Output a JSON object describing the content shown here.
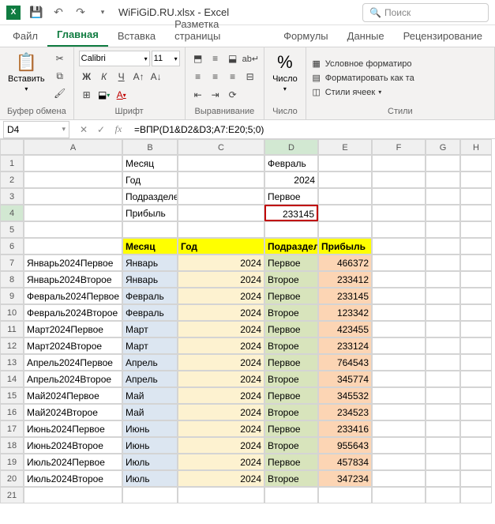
{
  "title": "WiFiGiD.RU.xlsx - Excel",
  "search_placeholder": "Поиск",
  "tabs": [
    "Файл",
    "Главная",
    "Вставка",
    "Разметка страницы",
    "Формулы",
    "Данные",
    "Рецензирование"
  ],
  "active_tab": 1,
  "paste_label": "Вставить",
  "clipboard_group": "Буфер обмена",
  "font_group": "Шрифт",
  "align_group": "Выравнивание",
  "number_group": "Число",
  "styles_group": "Стили",
  "font_name": "Calibri",
  "font_size": "11",
  "style_links": {
    "cond": "Условное форматиро",
    "table": "Форматировать как та",
    "cell": "Стили ячеек"
  },
  "namebox": "D4",
  "formula": "=ВПР(D1&D2&D3;A7:E20;5;0)",
  "cols": [
    "",
    "A",
    "B",
    "C",
    "D",
    "E",
    "F",
    "G",
    "H"
  ],
  "rows": [
    {
      "n": 1,
      "b": "Месяц",
      "d": "Февраль"
    },
    {
      "n": 2,
      "b": "Год",
      "d": "2024"
    },
    {
      "n": 3,
      "b": "Подразделение",
      "d": "Первое"
    },
    {
      "n": 4,
      "b": "Прибыль",
      "d": "233145"
    },
    {
      "n": 5
    },
    {
      "n": 6,
      "hdr": true,
      "b": "Месяц",
      "c": "Год",
      "d": "Подразделение",
      "e": "Прибыль"
    },
    {
      "n": 7,
      "a": "Январь2024Первое",
      "b": "Январь",
      "c": "2024",
      "d": "Первое",
      "e": "466372"
    },
    {
      "n": 8,
      "a": "Январь2024Второе",
      "b": "Январь",
      "c": "2024",
      "d": "Второе",
      "e": "233412"
    },
    {
      "n": 9,
      "a": "Февраль2024Первое",
      "b": "Февраль",
      "c": "2024",
      "d": "Первое",
      "e": "233145"
    },
    {
      "n": 10,
      "a": "Февраль2024Второе",
      "b": "Февраль",
      "c": "2024",
      "d": "Второе",
      "e": "123342"
    },
    {
      "n": 11,
      "a": "Март2024Первое",
      "b": "Март",
      "c": "2024",
      "d": "Первое",
      "e": "423455"
    },
    {
      "n": 12,
      "a": "Март2024Второе",
      "b": "Март",
      "c": "2024",
      "d": "Второе",
      "e": "233124"
    },
    {
      "n": 13,
      "a": "Апрель2024Первое",
      "b": "Апрель",
      "c": "2024",
      "d": "Первое",
      "e": "764543"
    },
    {
      "n": 14,
      "a": "Апрель2024Второе",
      "b": "Апрель",
      "c": "2024",
      "d": "Второе",
      "e": "345774"
    },
    {
      "n": 15,
      "a": "Май2024Первое",
      "b": "Май",
      "c": "2024",
      "d": "Первое",
      "e": "345532"
    },
    {
      "n": 16,
      "a": "Май2024Второе",
      "b": "Май",
      "c": "2024",
      "d": "Второе",
      "e": "234523"
    },
    {
      "n": 17,
      "a": "Июнь2024Первое",
      "b": "Июнь",
      "c": "2024",
      "d": "Первое",
      "e": "233416"
    },
    {
      "n": 18,
      "a": "Июнь2024Второе",
      "b": "Июнь",
      "c": "2024",
      "d": "Второе",
      "e": "955643"
    },
    {
      "n": 19,
      "a": "Июль2024Первое",
      "b": "Июль",
      "c": "2024",
      "d": "Первое",
      "e": "457834"
    },
    {
      "n": 20,
      "a": "Июль2024Второе",
      "b": "Июль",
      "c": "2024",
      "d": "Второе",
      "e": "347234"
    },
    {
      "n": 21
    }
  ]
}
